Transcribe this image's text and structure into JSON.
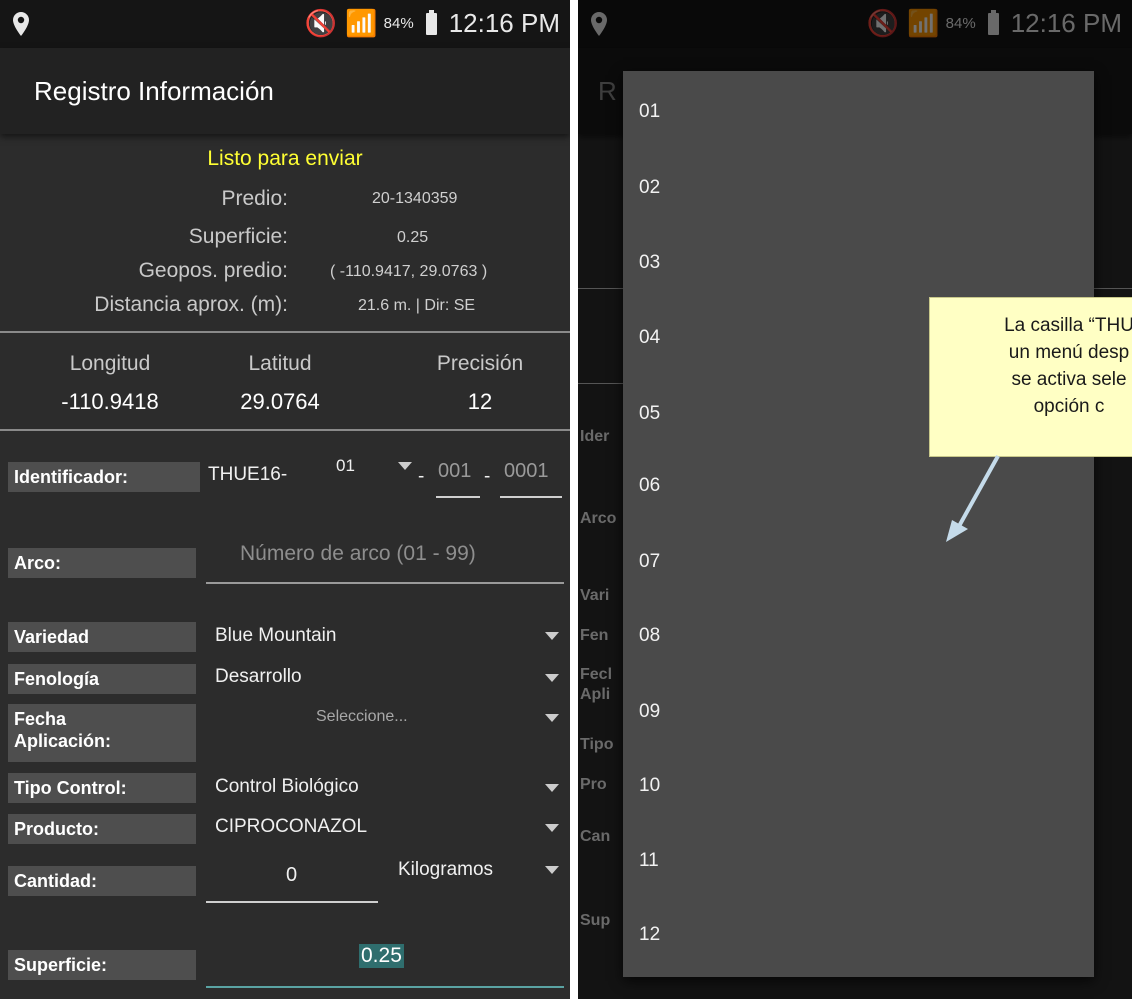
{
  "status_bar": {
    "battery": "84%",
    "time": "12:16 PM"
  },
  "app": {
    "title": "Registro Información"
  },
  "info": {
    "status": "Listo para enviar",
    "predio_label": "Predio:",
    "predio_value": "20-1340359",
    "superficie_label": "Superficie:",
    "superficie_value": "0.25",
    "geopos_label": "Geopos. predio:",
    "geopos_value": "( -110.9417, 29.0763 )",
    "distancia_label": "Distancia aprox. (m):",
    "distancia_value": "21.6 m. | Dir: SE"
  },
  "coords": {
    "longitud_label": "Longitud",
    "longitud_value": "-110.9418",
    "latitud_label": "Latitud",
    "latitud_value": "29.0764",
    "precision_label": "Precisión",
    "precision_value": "12"
  },
  "form": {
    "identificador": {
      "label": "Identificador:",
      "prefix": "THUE16-",
      "selected": "01",
      "sep1": "-",
      "part2": "001",
      "sep2": "-",
      "part3": "0001"
    },
    "arco": {
      "label": "Arco:",
      "placeholder": "Número de arco (01 - 99)"
    },
    "variedad": {
      "label": "Variedad",
      "value": "Blue Mountain"
    },
    "fenologia": {
      "label": "Fenología",
      "value": "Desarrollo"
    },
    "fecha": {
      "label_line1": "Fecha",
      "label_line2": "Aplicación:",
      "value": "Seleccione..."
    },
    "tipo_control": {
      "label": "Tipo Control:",
      "value": "Control Biológico"
    },
    "producto": {
      "label": "Producto:",
      "value": "CIPROCONAZOL"
    },
    "cantidad": {
      "label": "Cantidad:",
      "value": "0",
      "unit": "Kilogramos"
    },
    "superficie": {
      "label": "Superficie:",
      "value": "0.25"
    }
  },
  "right_bg": {
    "title_fragment": "R",
    "labels": [
      "Ider",
      "Arco",
      "Vari",
      "Fen",
      "Fecl",
      "Apli",
      "Tipo",
      "Pro",
      "Can",
      "Sup"
    ]
  },
  "dropdown": {
    "options": [
      "01",
      "02",
      "03",
      "04",
      "05",
      "06",
      "07",
      "08",
      "09",
      "10",
      "11",
      "12"
    ]
  },
  "callout": {
    "lines": [
      "La casilla “THU",
      "un menú desp",
      "se activa sele",
      "opción c"
    ]
  },
  "colors": {
    "status_ready": "#ffff33",
    "background": "#2c2c2c",
    "field_label_bg": "#4e4e4e",
    "callout_bg": "#ffffc4",
    "arrow": "#c5dbea"
  }
}
